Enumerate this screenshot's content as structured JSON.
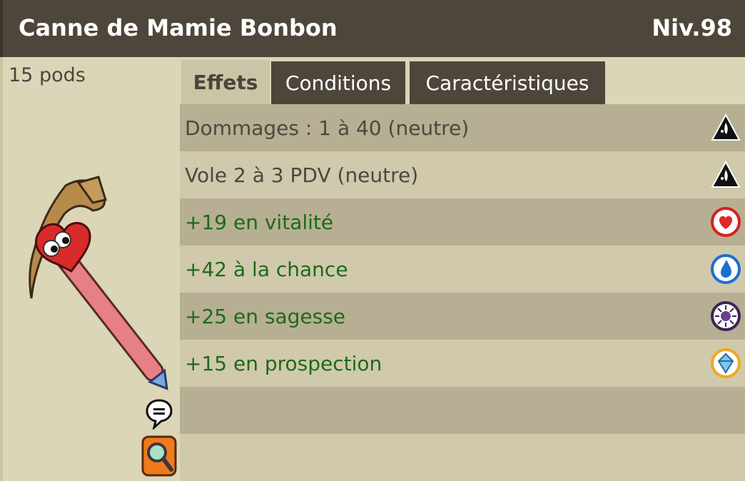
{
  "header": {
    "title": "Canne de Mamie Bonbon",
    "level": "Niv.98"
  },
  "item": {
    "pods": "15 pods"
  },
  "tabs": [
    {
      "label": "Effets",
      "active": true
    },
    {
      "label": "Conditions",
      "active": false
    },
    {
      "label": "Caractéristiques",
      "active": false
    }
  ],
  "effects": [
    {
      "text": "Dommages : 1 à 40 (neutre)",
      "kind": "neutral",
      "icon": "neutral-element-icon"
    },
    {
      "text": "Vole 2 à 3 PDV (neutre)",
      "kind": "neutral",
      "icon": "neutral-element-icon"
    },
    {
      "text": "+19 en vitalité",
      "kind": "bonus",
      "icon": "vitality-heart-icon"
    },
    {
      "text": "+42 à la chance",
      "kind": "bonus",
      "icon": "chance-water-drop-icon"
    },
    {
      "text": "+25 en sagesse",
      "kind": "bonus",
      "icon": "wisdom-icon"
    },
    {
      "text": "+15 en prospection",
      "kind": "bonus",
      "icon": "prospecting-icon"
    }
  ],
  "colors": {
    "header_bg": "#4e463b",
    "panel_bg": "#dad6b7",
    "row_dark": "#b7af93",
    "row_light": "#d0c9ac",
    "bonus_text": "#1d6a1a",
    "neutral_text": "#4d483f"
  }
}
